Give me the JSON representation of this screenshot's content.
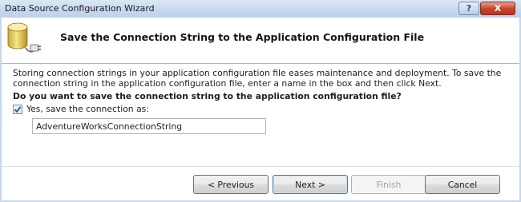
{
  "window": {
    "title": "Data Source Configuration Wizard",
    "help_glyph": "?",
    "close_glyph": "X"
  },
  "header": {
    "title": "Save the Connection String to the Application Configuration File",
    "icon": "database-plug-icon"
  },
  "body": {
    "description": "Storing connection strings in your application configuration file eases maintenance and deployment. To save the connection string in the application configuration file, enter a name in the box and then click Next.",
    "question": "Do you want to save the connection string to the application configuration file?",
    "save_checkbox": {
      "label": "Yes, save the connection as:",
      "checked": true
    },
    "connection_name": {
      "value": "AdventureWorksConnectionString"
    }
  },
  "buttons": {
    "previous": "< Previous",
    "next": "Next >",
    "finish": "Finish",
    "cancel": "Cancel"
  },
  "colors": {
    "titlebar": "#c6d8ee",
    "close_button": "#c4412a",
    "default_button_border": "#3c7fb1"
  }
}
